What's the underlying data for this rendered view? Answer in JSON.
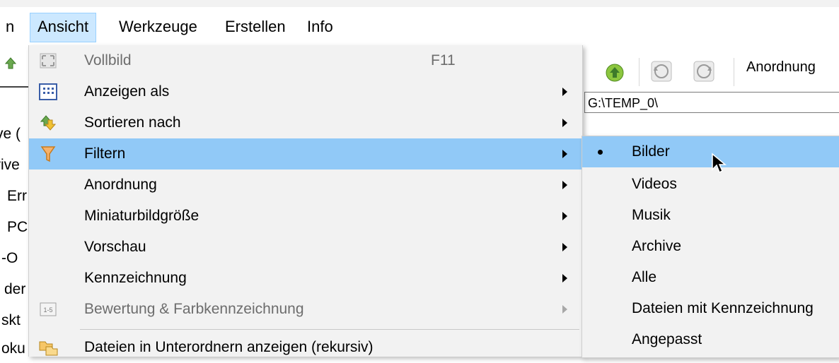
{
  "menubar": {
    "items": [
      "n",
      "Ansicht",
      "Werkzeuge",
      "Erstellen",
      "Info"
    ],
    "active": "Ansicht"
  },
  "left_tree": [
    "ve (",
    "rive",
    "Err",
    "PC",
    "-O",
    "der",
    "skt",
    "oku"
  ],
  "toolbar": {
    "icons": [
      "back-up-icon",
      "rotate-left-icon",
      "rotate-right-icon"
    ],
    "anordnung_label": "Anordnung"
  },
  "path_bar": {
    "value": "G:\\TEMP_0\\"
  },
  "dropdown": {
    "items": [
      {
        "label": "Vollbild",
        "shortcut": "F11",
        "icon": "fullscreen-icon",
        "disabled": true,
        "submenu": false
      },
      {
        "label": "Anzeigen als",
        "shortcut": "",
        "icon": "grid-view-icon",
        "disabled": false,
        "submenu": true
      },
      {
        "label": "Sortieren nach",
        "shortcut": "",
        "icon": "sort-icon",
        "disabled": false,
        "submenu": true
      },
      {
        "label": "Filtern",
        "shortcut": "",
        "icon": "filter-funnel-icon",
        "disabled": false,
        "submenu": true,
        "highlighted": true
      },
      {
        "label": "Anordnung",
        "shortcut": "",
        "icon": "",
        "disabled": false,
        "submenu": true
      },
      {
        "label": "Miniaturbildgröße",
        "shortcut": "",
        "icon": "",
        "disabled": false,
        "submenu": true
      },
      {
        "label": "Vorschau",
        "shortcut": "",
        "icon": "",
        "disabled": false,
        "submenu": true
      },
      {
        "label": "Kennzeichnung",
        "shortcut": "",
        "icon": "",
        "disabled": false,
        "submenu": true
      },
      {
        "label": "Bewertung & Farbkennzeichnung",
        "shortcut": "",
        "icon": "rating-icon",
        "disabled": true,
        "submenu": true
      },
      {
        "label": "Dateien in Unterordnern anzeigen (rekursiv)",
        "shortcut": "",
        "icon": "subfolder-icon",
        "disabled": false,
        "submenu": false
      }
    ],
    "rating_icon_text": "1-5"
  },
  "filter_submenu": {
    "items": [
      {
        "label": "Bilder",
        "selected": true
      },
      {
        "label": "Videos",
        "selected": false
      },
      {
        "label": "Musik",
        "selected": false
      },
      {
        "label": "Archive",
        "selected": false
      },
      {
        "label": "Alle",
        "selected": false
      },
      {
        "label": "Dateien mit Kennzeichnung",
        "selected": false
      },
      {
        "label": "Angepasst",
        "selected": false
      }
    ]
  },
  "colors": {
    "highlight": "#91c9f7",
    "menu_bg": "#f2f2f2",
    "active_menubar": "#cce8ff",
    "disabled_text": "#6d6d6d"
  }
}
